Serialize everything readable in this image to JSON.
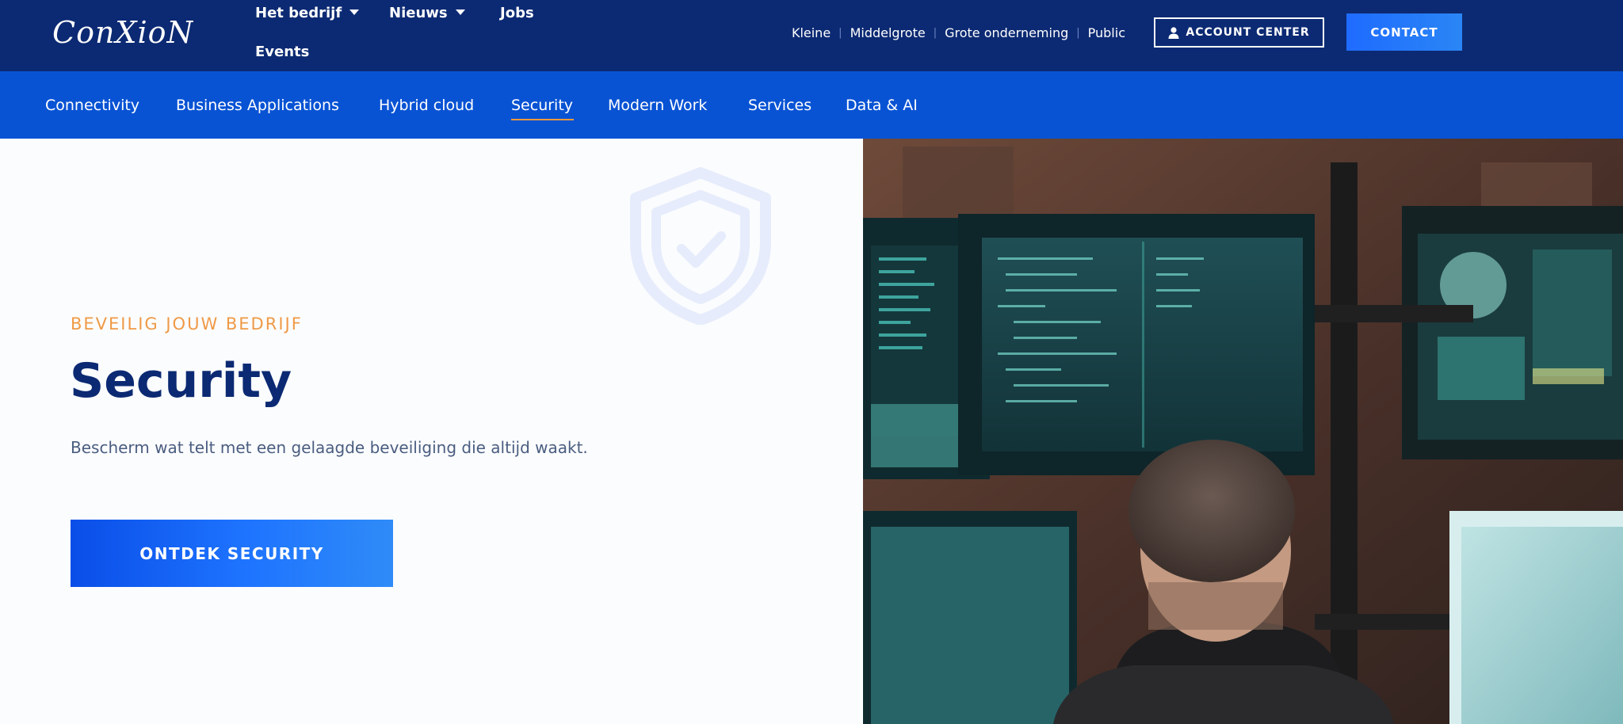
{
  "brand": {
    "logo_text": "ConXioN"
  },
  "main_nav": {
    "items": [
      {
        "label": "Het bedrijf",
        "has_dropdown": true
      },
      {
        "label": "Nieuws",
        "has_dropdown": true
      },
      {
        "label": "Jobs",
        "has_dropdown": false
      },
      {
        "label": "Events",
        "has_dropdown": false
      }
    ]
  },
  "segments": [
    "Kleine",
    "Middelgrote",
    "Grote onderneming",
    "Public"
  ],
  "header_buttons": {
    "account_label": "ACCOUNT CENTER",
    "contact_label": "CONTACT"
  },
  "sub_nav": {
    "items": [
      "Connectivity",
      "Business Applications",
      "Hybrid cloud",
      "Security",
      "Modern Work",
      "Services",
      "Data & AI"
    ],
    "active": "Security"
  },
  "hero": {
    "eyebrow": "BEVEILIG JOUW BEDRIJF",
    "title": "Security",
    "description": "Bescherm wat telt met een gelaagde beveiliging die altijd waakt.",
    "cta_label": "ONTDEK SECURITY",
    "image_icon": "shield-check-icon"
  },
  "colors": {
    "topbar": "#0c2a73",
    "subnav": "#0853d4",
    "accent_orange": "#ef9a46",
    "title_navy": "#0c2a73",
    "button_blue": "#1e74ff"
  }
}
